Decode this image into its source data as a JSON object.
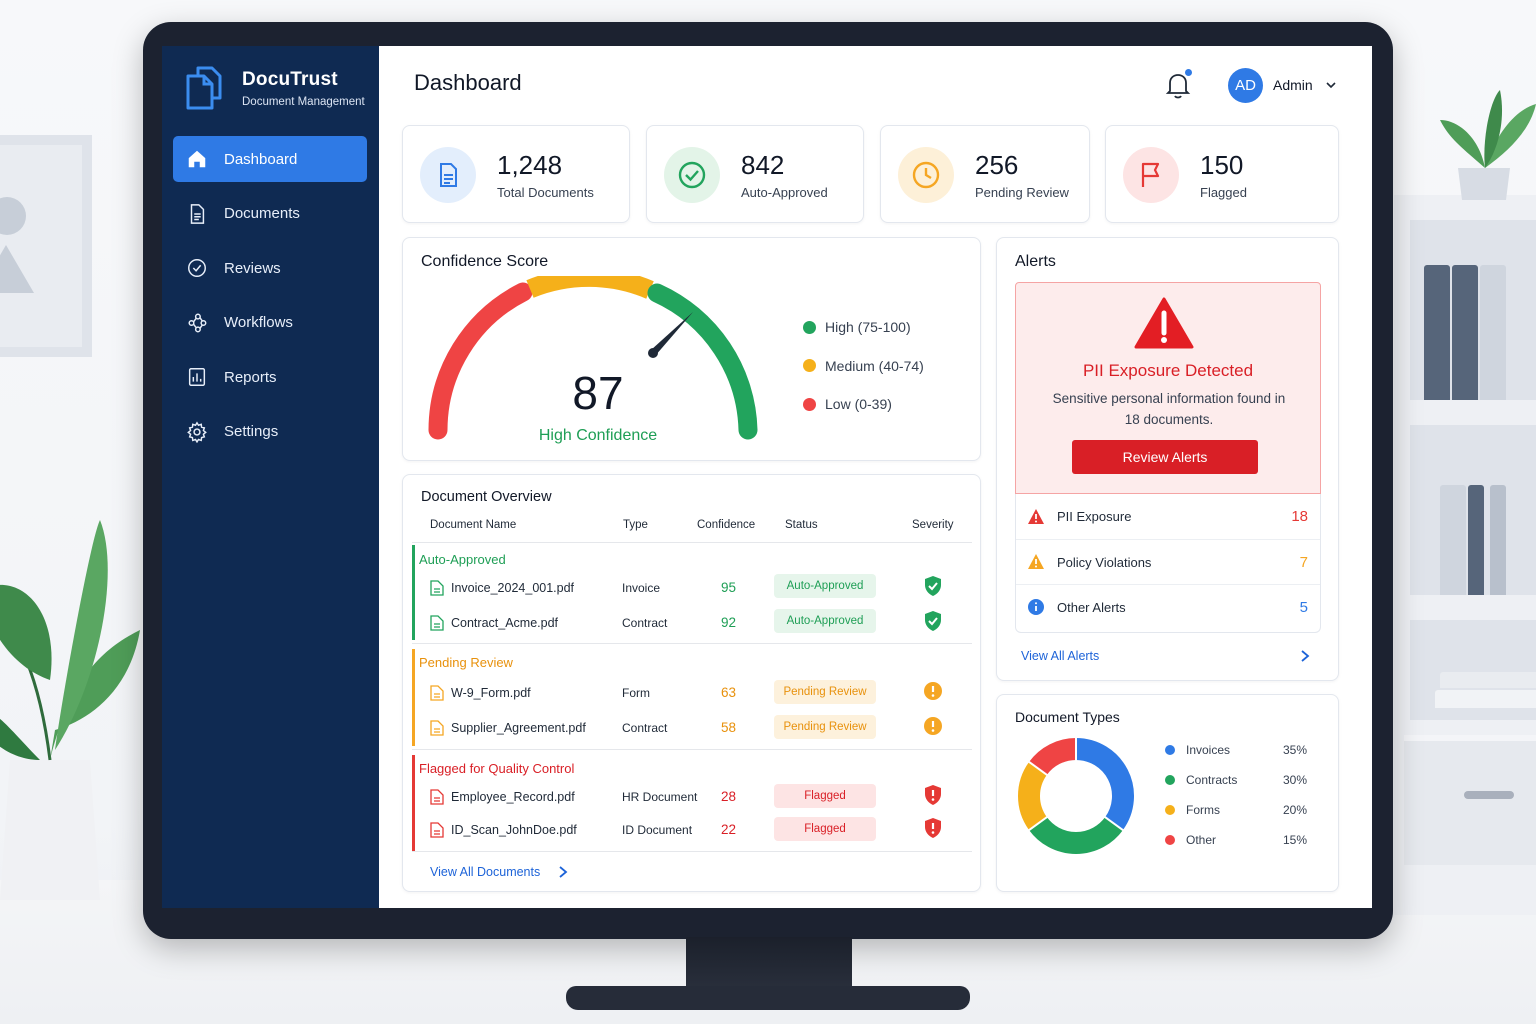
{
  "brand": {
    "name": "DocuTrust",
    "subtitle": "Document Management"
  },
  "nav": [
    {
      "label": "Dashboard",
      "icon": "home-icon",
      "active": true
    },
    {
      "label": "Documents",
      "icon": "document-icon"
    },
    {
      "label": "Reviews",
      "icon": "check-circle-icon"
    },
    {
      "label": "Workflows",
      "icon": "workflow-icon"
    },
    {
      "label": "Reports",
      "icon": "report-icon"
    },
    {
      "label": "Settings",
      "icon": "gear-icon"
    }
  ],
  "header": {
    "title": "Dashboard",
    "user_initials": "AD",
    "user_name": "Admin"
  },
  "stats": [
    {
      "value": "1,248",
      "label": "Total Documents",
      "icon": "document-icon",
      "color": "#2f7ae5"
    },
    {
      "value": "842",
      "label": "Auto-Approved",
      "icon": "check-circle-icon",
      "color": "#22a45d"
    },
    {
      "value": "256",
      "label": "Pending Review",
      "icon": "clock-icon",
      "color": "#f5a623"
    },
    {
      "value": "150",
      "label": "Flagged",
      "icon": "flag-icon",
      "color": "#e53935"
    }
  ],
  "confidence": {
    "title": "Confidence Score",
    "score": 87,
    "score_label": "High Confidence",
    "legend": [
      {
        "label": "High (75-100)",
        "color": "#22a45d"
      },
      {
        "label": "Medium (40-74)",
        "color": "#f5b01a"
      },
      {
        "label": "Low (0-39)",
        "color": "#ef4444"
      }
    ]
  },
  "overview": {
    "title": "Document Overview",
    "columns": [
      "Document Name",
      "Type",
      "Confidence",
      "Status",
      "Severity"
    ],
    "groups": [
      {
        "label": "Auto-Approved",
        "color": "#22a45d",
        "rows": [
          {
            "name": "Invoice_2024_001.pdf",
            "type": "Invoice",
            "confidence": "95",
            "status": "Auto-Approved"
          },
          {
            "name": "Contract_Acme.pdf",
            "type": "Contract",
            "confidence": "92",
            "status": "Auto-Approved"
          }
        ]
      },
      {
        "label": "Pending Review",
        "color": "#f5a623",
        "rows": [
          {
            "name": "W-9_Form.pdf",
            "type": "Form",
            "confidence": "63",
            "status": "Pending Review"
          },
          {
            "name": "Supplier_Agreement.pdf",
            "type": "Contract",
            "confidence": "58",
            "status": "Pending Review"
          }
        ]
      },
      {
        "label": "Flagged for Quality Control",
        "color": "#e53935",
        "rows": [
          {
            "name": "Employee_Record.pdf",
            "type": "HR Document",
            "confidence": "28",
            "status": "Flagged"
          },
          {
            "name": "ID_Scan_JohnDoe.pdf",
            "type": "ID Document",
            "confidence": "22",
            "status": "Flagged"
          }
        ]
      }
    ],
    "view_all": "View All Documents"
  },
  "alerts": {
    "title": "Alerts",
    "banner_title": "PII Exposure Detected",
    "banner_desc": "Sensitive personal information found in 18 documents.",
    "banner_button": "Review Alerts",
    "items": [
      {
        "label": "PII Exposure",
        "count": "18",
        "color": "#e53935"
      },
      {
        "label": "Policy Violations",
        "count": "7",
        "color": "#f5a623"
      },
      {
        "label": "Other Alerts",
        "count": "5",
        "color": "#2f7ae5"
      }
    ],
    "view_all": "View All Alerts"
  },
  "doc_types": {
    "title": "Document Types",
    "chart_data": {
      "type": "pie",
      "categories": [
        "Invoices",
        "Contracts",
        "Forms",
        "Other"
      ],
      "values": [
        35,
        30,
        20,
        15
      ],
      "labels": [
        "35%",
        "30%",
        "20%",
        "15%"
      ],
      "colors": [
        "#2f7ae5",
        "#22a45d",
        "#f5b01a",
        "#ef4444"
      ]
    }
  }
}
